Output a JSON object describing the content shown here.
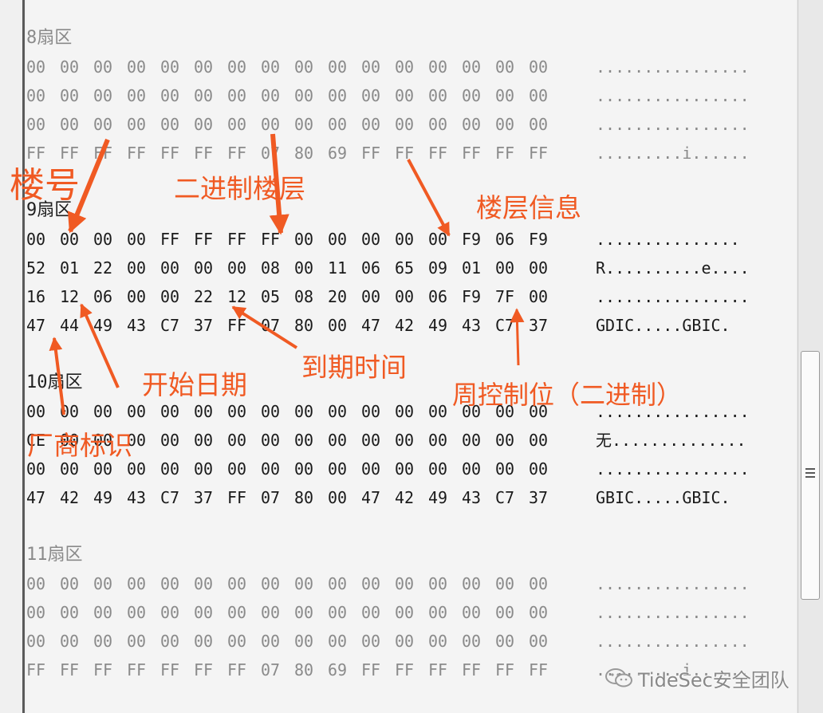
{
  "sectors": [
    {
      "id": "8",
      "title": "8扇区",
      "dim": true,
      "rows": [
        {
          "bytes": [
            "00",
            "00",
            "00",
            "00",
            "00",
            "00",
            "00",
            "00",
            "00",
            "00",
            "00",
            "00",
            "00",
            "00",
            "00",
            "00"
          ],
          "ascii": "................"
        },
        {
          "bytes": [
            "00",
            "00",
            "00",
            "00",
            "00",
            "00",
            "00",
            "00",
            "00",
            "00",
            "00",
            "00",
            "00",
            "00",
            "00",
            "00"
          ],
          "ascii": "................"
        },
        {
          "bytes": [
            "00",
            "00",
            "00",
            "00",
            "00",
            "00",
            "00",
            "00",
            "00",
            "00",
            "00",
            "00",
            "00",
            "00",
            "00",
            "00"
          ],
          "ascii": "................"
        },
        {
          "bytes": [
            "FF",
            "FF",
            "FF",
            "FF",
            "FF",
            "FF",
            "FF",
            "07",
            "80",
            "69",
            "FF",
            "FF",
            "FF",
            "FF",
            "FF",
            "FF"
          ],
          "ascii": ".........i......"
        }
      ]
    },
    {
      "id": "9",
      "title": "9扇区",
      "dim": false,
      "rows": [
        {
          "bytes": [
            "00",
            "00",
            "00",
            "00",
            "FF",
            "FF",
            "FF",
            "FF",
            "00",
            "00",
            "00",
            "00",
            "00",
            "F9",
            "06",
            "F9"
          ],
          "ascii": "..............."
        },
        {
          "bytes": [
            "52",
            "01",
            "22",
            "00",
            "00",
            "00",
            "00",
            "08",
            "00",
            "11",
            "06",
            "65",
            "09",
            "01",
            "00",
            "00"
          ],
          "ascii": "R..........e...."
        },
        {
          "bytes": [
            "16",
            "12",
            "06",
            "00",
            "00",
            "22",
            "12",
            "05",
            "08",
            "20",
            "00",
            "00",
            "06",
            "F9",
            "7F",
            "00"
          ],
          "ascii": "................"
        },
        {
          "bytes": [
            "47",
            "44",
            "49",
            "43",
            "C7",
            "37",
            "FF",
            "07",
            "80",
            "00",
            "47",
            "42",
            "49",
            "43",
            "C7",
            "37"
          ],
          "ascii": "GDIC.....GBIC."
        }
      ]
    },
    {
      "id": "10",
      "title": "10扇区",
      "dim": false,
      "rows": [
        {
          "bytes": [
            "00",
            "00",
            "00",
            "00",
            "00",
            "00",
            "00",
            "00",
            "00",
            "00",
            "00",
            "00",
            "00",
            "00",
            "00",
            "00"
          ],
          "ascii": "................"
        },
        {
          "bytes": [
            "CE",
            "00",
            "00",
            "00",
            "00",
            "00",
            "00",
            "00",
            "00",
            "00",
            "00",
            "00",
            "00",
            "00",
            "00",
            "00"
          ],
          "ascii": "无.............."
        },
        {
          "bytes": [
            "00",
            "00",
            "00",
            "00",
            "00",
            "00",
            "00",
            "00",
            "00",
            "00",
            "00",
            "00",
            "00",
            "00",
            "00",
            "00"
          ],
          "ascii": "................"
        },
        {
          "bytes": [
            "47",
            "42",
            "49",
            "43",
            "C7",
            "37",
            "FF",
            "07",
            "80",
            "00",
            "47",
            "42",
            "49",
            "43",
            "C7",
            "37"
          ],
          "ascii": "GBIC.....GBIC."
        }
      ]
    },
    {
      "id": "11",
      "title": "11扇区",
      "dim": true,
      "rows": [
        {
          "bytes": [
            "00",
            "00",
            "00",
            "00",
            "00",
            "00",
            "00",
            "00",
            "00",
            "00",
            "00",
            "00",
            "00",
            "00",
            "00",
            "00"
          ],
          "ascii": "................"
        },
        {
          "bytes": [
            "00",
            "00",
            "00",
            "00",
            "00",
            "00",
            "00",
            "00",
            "00",
            "00",
            "00",
            "00",
            "00",
            "00",
            "00",
            "00"
          ],
          "ascii": "................"
        },
        {
          "bytes": [
            "00",
            "00",
            "00",
            "00",
            "00",
            "00",
            "00",
            "00",
            "00",
            "00",
            "00",
            "00",
            "00",
            "00",
            "00",
            "00"
          ],
          "ascii": "................"
        },
        {
          "bytes": [
            "FF",
            "FF",
            "FF",
            "FF",
            "FF",
            "FF",
            "FF",
            "07",
            "80",
            "69",
            "FF",
            "FF",
            "FF",
            "FF",
            "FF",
            "FF"
          ],
          "ascii": ".........i......"
        }
      ]
    }
  ],
  "annotations": {
    "color": "#f05a23",
    "building_number": "楼号",
    "binary_floor": "二进制楼层",
    "floor_info": "楼层信息",
    "expiry_time": "到期时间",
    "start_date": "开始日期",
    "week_control_bits": "周控制位（二进制）",
    "vendor_id": "厂商标识"
  },
  "watermark": {
    "icon": "wechat-icon",
    "text": "TideSec安全团队"
  }
}
